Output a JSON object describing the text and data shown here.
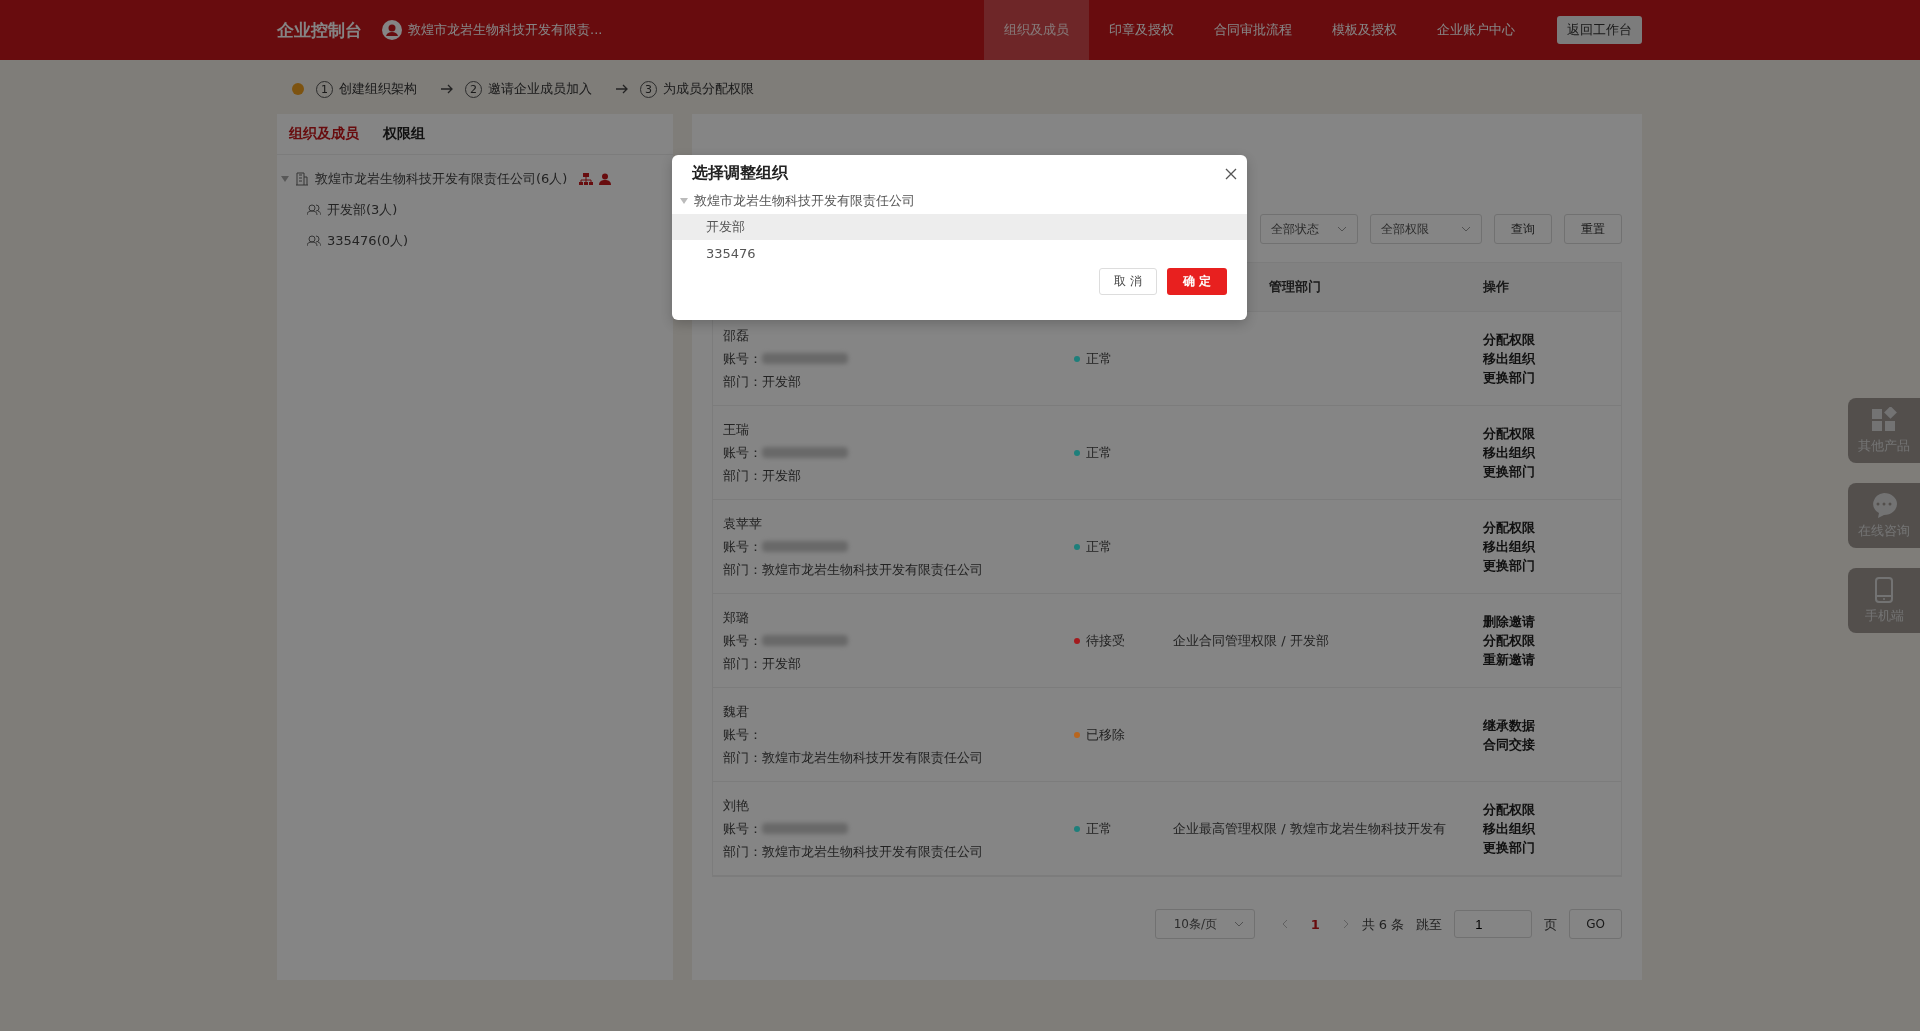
{
  "header": {
    "title": "企业控制台",
    "company": "敦煌市龙岩生物科技开发有限责...",
    "nav": [
      {
        "label": "组织及成员",
        "selected": true
      },
      {
        "label": "印章及授权",
        "selected": false
      },
      {
        "label": "合同审批流程",
        "selected": false
      },
      {
        "label": "模板及授权",
        "selected": false
      },
      {
        "label": "企业账户中心",
        "selected": false
      }
    ],
    "back_button": "返回工作台"
  },
  "steps": [
    {
      "number": "1",
      "label": "创建组织架构"
    },
    {
      "number": "2",
      "label": "邀请企业成员加入"
    },
    {
      "number": "3",
      "label": "为成员分配权限"
    }
  ],
  "sidebar": {
    "tabs": [
      {
        "label": "组织及成员",
        "selected": true
      },
      {
        "label": "权限组",
        "selected": false
      }
    ],
    "tree": [
      {
        "label": "敦煌市龙岩生物科技开发有限责任公司(6人)",
        "expanded": true,
        "children": [
          {
            "label": "开发部(3人)"
          },
          {
            "label": "335476(0人)"
          }
        ]
      }
    ]
  },
  "filters": {
    "status": "全部状态",
    "permission": "全部权限",
    "query_button": "查询",
    "reset_button": "重置"
  },
  "table": {
    "columns": [
      "管理部门",
      "操作"
    ],
    "rows": [
      {
        "name": "邵磊",
        "account_label": "账号：",
        "account_redacted": true,
        "department": "部门：开发部",
        "status": "正常",
        "color": "#1e7f7b",
        "permission": "",
        "actions": [
          "分配权限",
          "移出组织",
          "更换部门"
        ]
      },
      {
        "name": "王瑞",
        "account_label": "账号：",
        "account_redacted": true,
        "department": "部门：开发部",
        "status": "正常",
        "color": "#1e7f7b",
        "permission": "",
        "actions": [
          "分配权限",
          "移出组织",
          "更换部门"
        ]
      },
      {
        "name": "袁苹苹",
        "account_label": "账号：",
        "account_redacted": true,
        "department": "部门：敦煌市龙岩生物科技开发有限责任公司",
        "status": "正常",
        "color": "#1e7f7b",
        "permission": "",
        "actions": [
          "分配权限",
          "移出组织",
          "更换部门"
        ]
      },
      {
        "name": "郑璐",
        "account_label": "账号：",
        "account_redacted": true,
        "department": "部门：开发部",
        "status": "待接受",
        "color": "#a31a1d",
        "permission": "企业合同管理权限 / 开发部",
        "actions": [
          "删除邀请",
          "分配权限",
          "重新邀请"
        ]
      },
      {
        "name": "魏君",
        "account_label": "账号：",
        "account_redacted": false,
        "department": "部门：敦煌市龙岩生物科技开发有限责任公司",
        "status": "已移除",
        "color": "#b8661e",
        "permission": "",
        "actions": [
          "继承数据",
          "合同交接"
        ]
      },
      {
        "name": "刘艳",
        "account_label": "账号：",
        "account_redacted": true,
        "department": "部门：敦煌市龙岩生物科技开发有限责任公司",
        "status": "正常",
        "color": "#1e7f7b",
        "permission": "企业最高管理权限 / 敦煌市龙岩生物科技开发有",
        "actions": [
          "分配权限",
          "移出组织",
          "更换部门"
        ]
      }
    ]
  },
  "pagination": {
    "page_size": "10条/页",
    "pages": [
      {
        "label": "1",
        "selected": true
      }
    ],
    "total": "共 6 条",
    "jump_label": "跳至",
    "jump_value": "1",
    "page_unit": "页",
    "go_button": "GO"
  },
  "side_buttons": [
    {
      "kind": "apps",
      "label": "其他产品"
    },
    {
      "kind": "chat",
      "label": "在线咨询"
    },
    {
      "kind": "phone",
      "label": "手机端"
    }
  ],
  "dialog": {
    "title": "选择调整组织",
    "tree": [
      {
        "label": "敦煌市龙岩生物科技开发有限责任公司",
        "expanded": true,
        "selected": false,
        "children": [
          {
            "label": "开发部",
            "selected": true
          },
          {
            "label": "335476",
            "selected": false
          }
        ]
      }
    ],
    "cancel_button": "取 消",
    "confirm_button": "确 定"
  }
}
